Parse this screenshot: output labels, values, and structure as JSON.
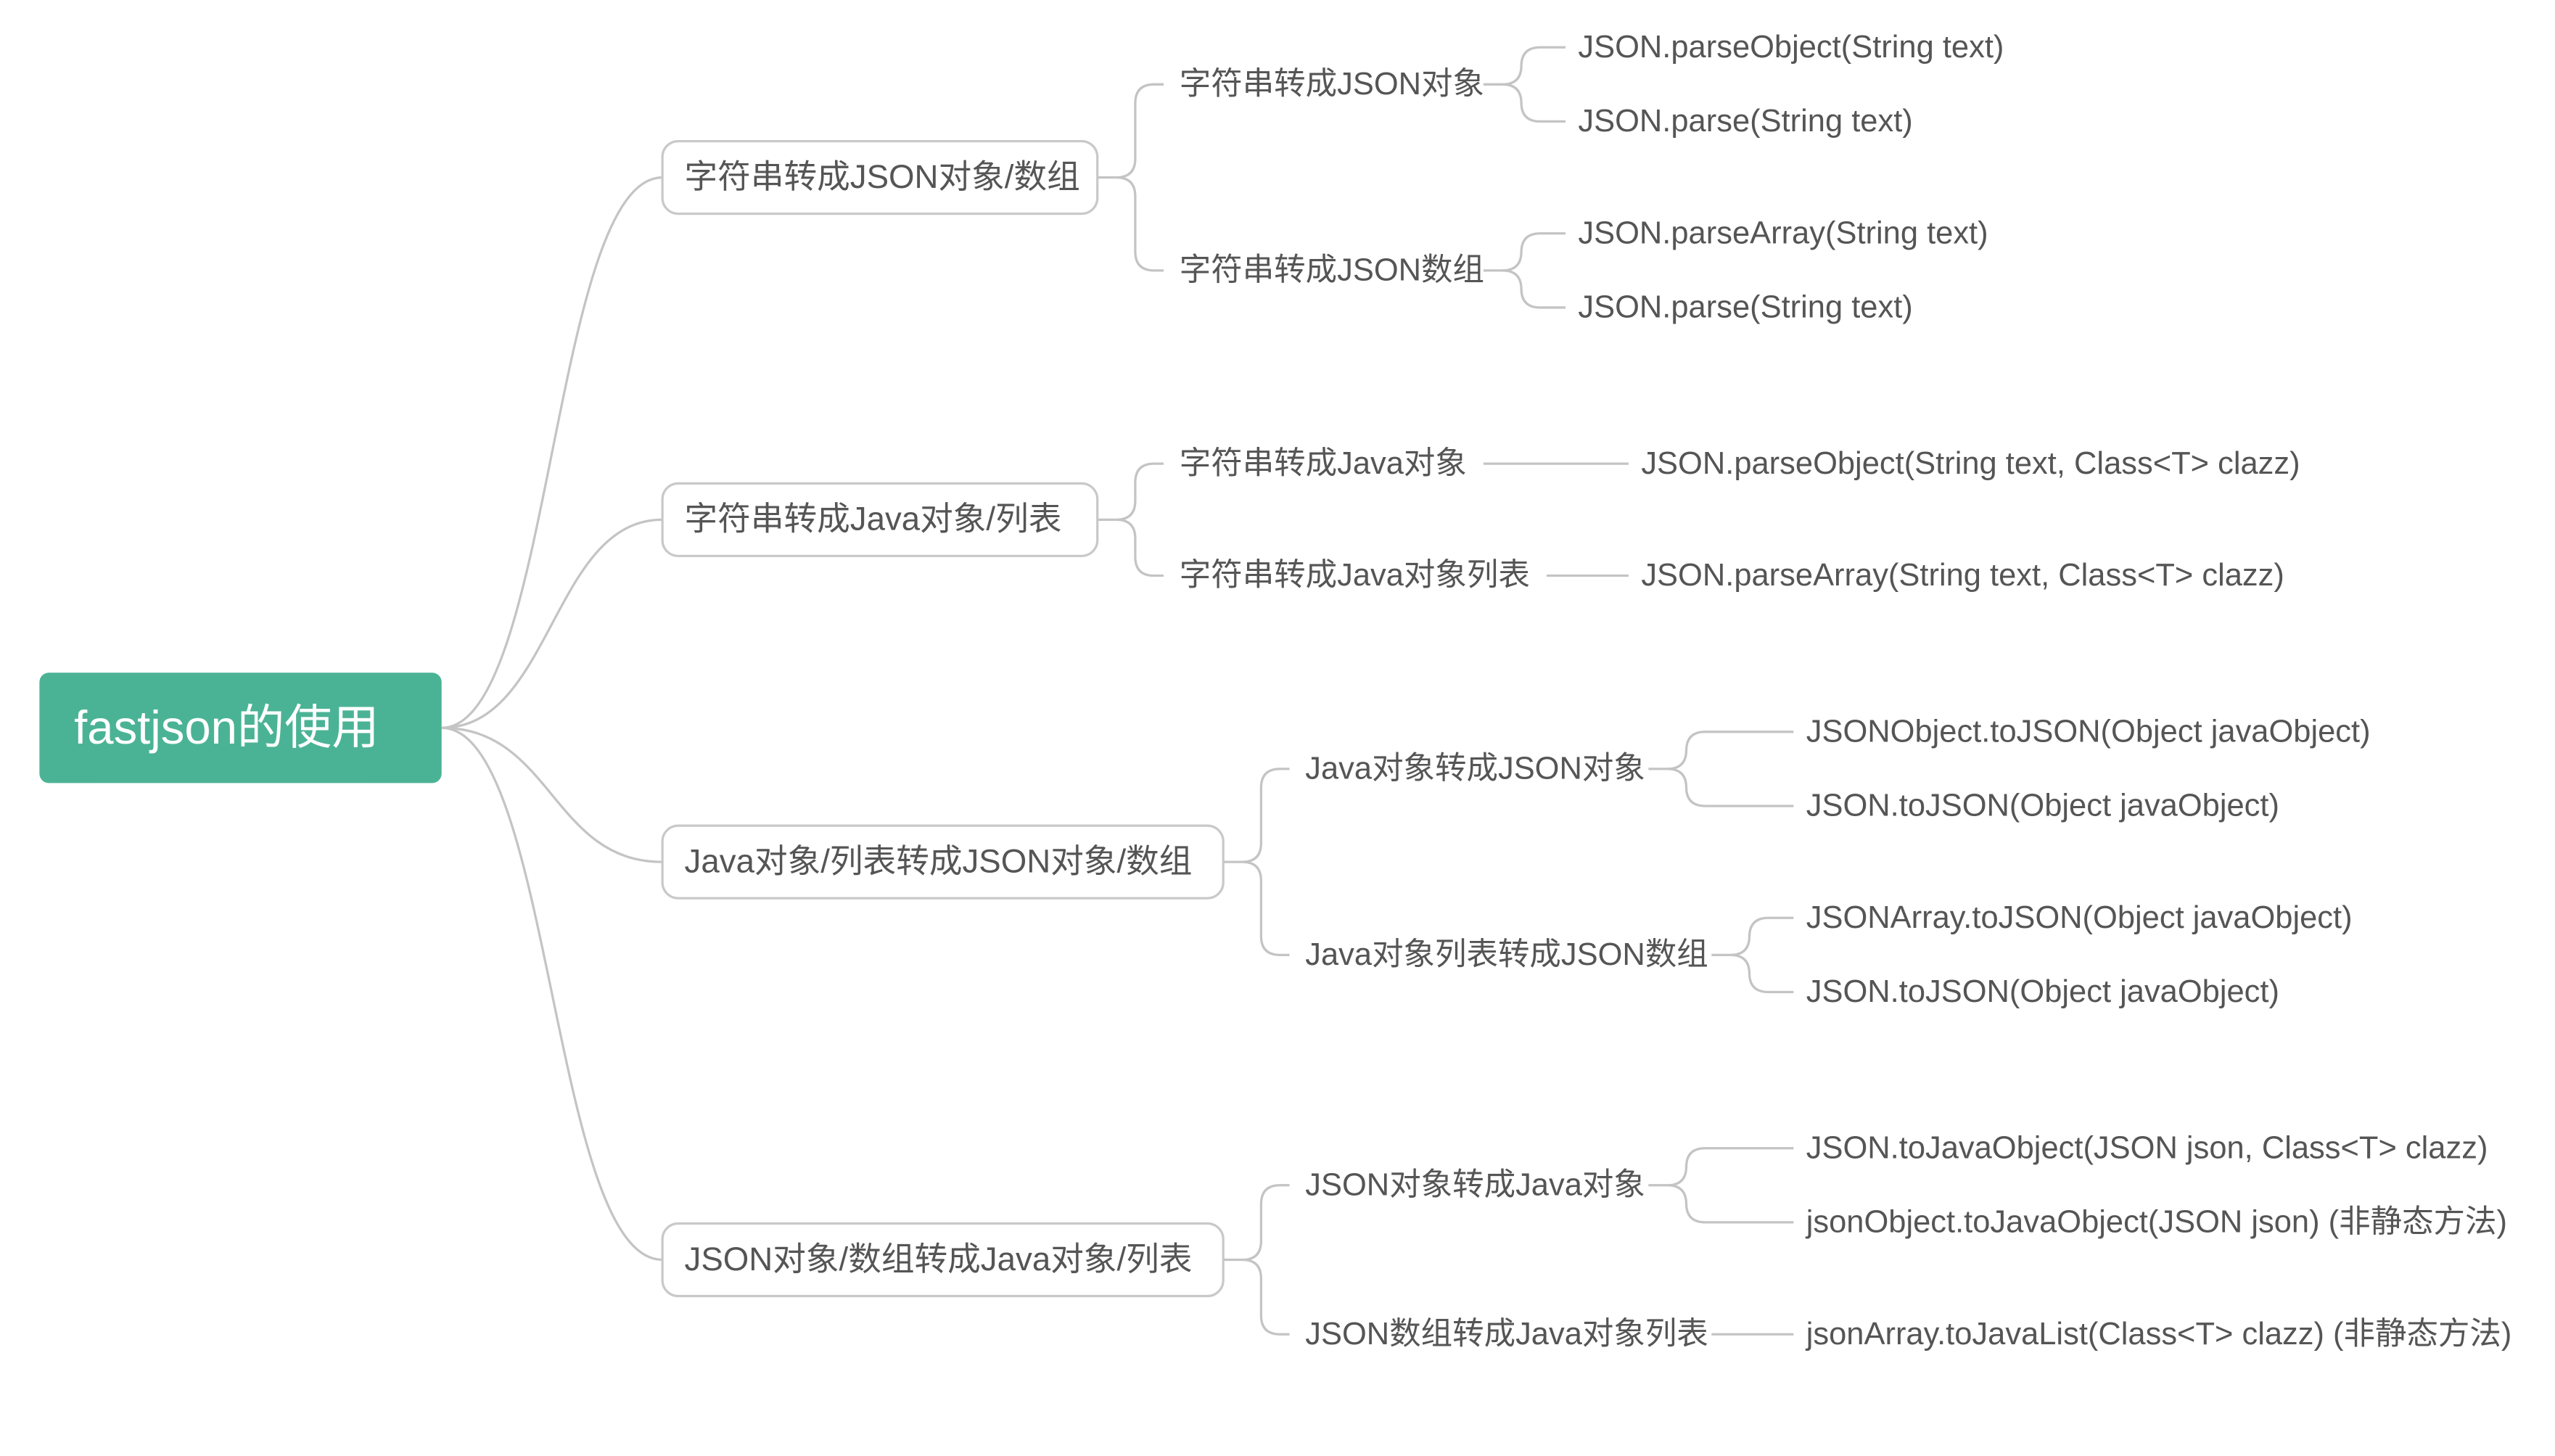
{
  "root": {
    "label": "fastjson的使用"
  },
  "branches": [
    {
      "label": "字符串转成JSON对象/数组",
      "children": [
        {
          "label": "字符串转成JSON对象",
          "leaves": [
            "JSON.parseObject(String text)",
            "JSON.parse(String text)"
          ]
        },
        {
          "label": "字符串转成JSON数组",
          "leaves": [
            "JSON.parseArray(String text)",
            "JSON.parse(String text)"
          ]
        }
      ]
    },
    {
      "label": "字符串转成Java对象/列表",
      "children": [
        {
          "label": "字符串转成Java对象",
          "leaves": [
            "JSON.parseObject(String text, Class<T> clazz)"
          ]
        },
        {
          "label": "字符串转成Java对象列表",
          "leaves": [
            "JSON.parseArray(String text, Class<T> clazz)"
          ]
        }
      ]
    },
    {
      "label": "Java对象/列表转成JSON对象/数组",
      "children": [
        {
          "label": "Java对象转成JSON对象",
          "leaves": [
            "JSONObject.toJSON(Object javaObject)",
            "JSON.toJSON(Object javaObject)"
          ]
        },
        {
          "label": "Java对象列表转成JSON数组",
          "leaves": [
            "JSONArray.toJSON(Object javaObject)",
            "JSON.toJSON(Object javaObject)"
          ]
        }
      ]
    },
    {
      "label": "JSON对象/数组转成Java对象/列表",
      "children": [
        {
          "label": "JSON对象转成Java对象",
          "leaves": [
            "JSON.toJavaObject(JSON json, Class<T> clazz)",
            "jsonObject.toJavaObject(JSON json) (非静态方法)"
          ]
        },
        {
          "label": "JSON数组转成Java对象列表",
          "leaves": [
            "jsonArray.toJavaList(Class<T> clazz) (非静态方法)"
          ]
        }
      ]
    }
  ]
}
